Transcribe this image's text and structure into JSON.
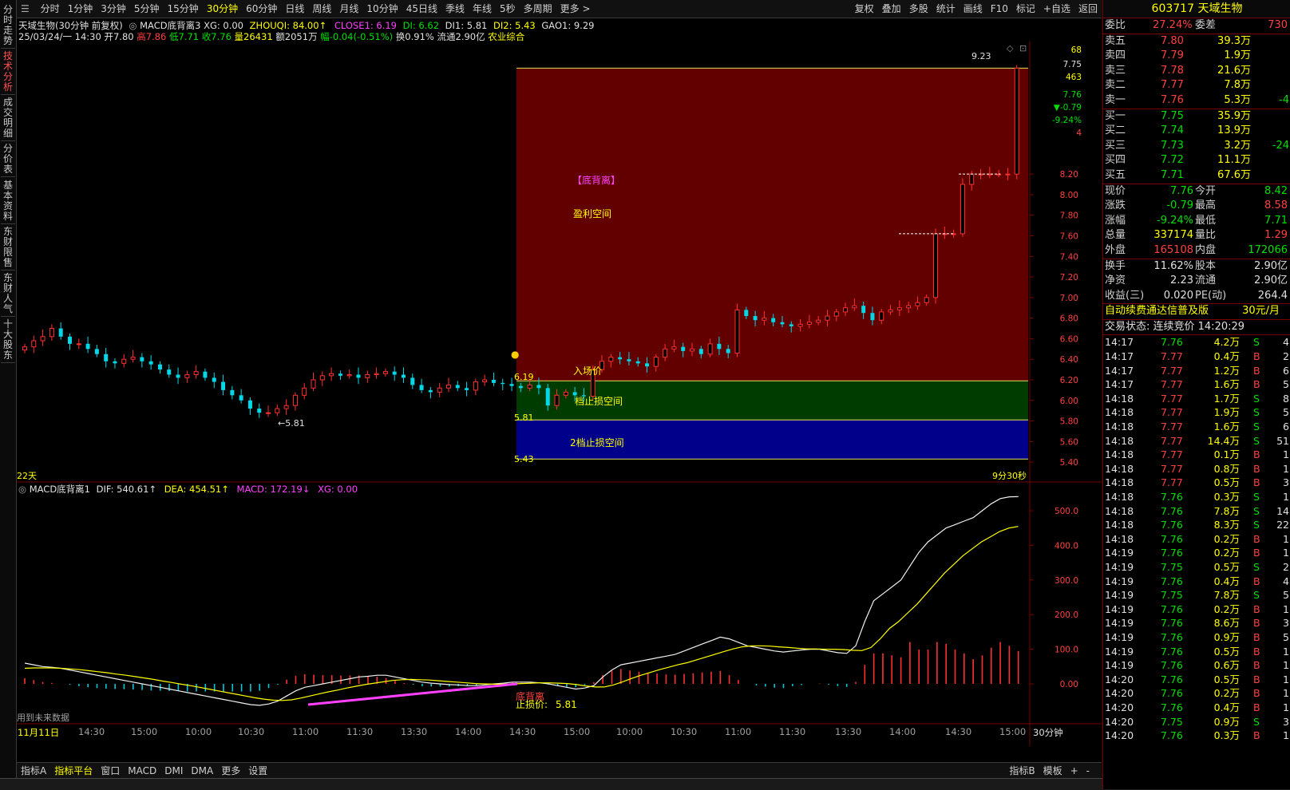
{
  "left_tabs": [
    {
      "label": "分时走势",
      "active": false
    },
    {
      "label": "技术分析",
      "active": true
    },
    {
      "label": "成交明细",
      "active": false
    },
    {
      "label": "分价表",
      "active": false
    },
    {
      "label": "基本资料",
      "active": false
    },
    {
      "label": "东财限售",
      "active": false
    },
    {
      "label": "东财人气",
      "active": false
    },
    {
      "label": "十大股东",
      "active": false
    }
  ],
  "periods": [
    {
      "label": "分时",
      "active": false
    },
    {
      "label": "1分钟",
      "active": false
    },
    {
      "label": "3分钟",
      "active": false
    },
    {
      "label": "5分钟",
      "active": false
    },
    {
      "label": "15分钟",
      "active": false
    },
    {
      "label": "30分钟",
      "active": true
    },
    {
      "label": "60分钟",
      "active": false
    },
    {
      "label": "日线",
      "active": false
    },
    {
      "label": "周线",
      "active": false
    },
    {
      "label": "月线",
      "active": false
    },
    {
      "label": "10分钟",
      "active": false
    },
    {
      "label": "45日线",
      "active": false
    },
    {
      "label": "季线",
      "active": false
    },
    {
      "label": "年线",
      "active": false
    },
    {
      "label": "5秒",
      "active": false
    },
    {
      "label": "多周期",
      "active": false
    },
    {
      "label": "更多 >",
      "active": false
    }
  ],
  "right_toolbar": [
    "复权",
    "叠加",
    "多股",
    "统计",
    "画线",
    "F10",
    "标记",
    "+自选",
    "返回"
  ],
  "info1": {
    "name": "天域生物(30分钟 前复权)",
    "formula": "MACD底背离3",
    "xg": "XG: 0.00",
    "zhouqi": "ZHOUQI: 84.00↑",
    "close1": "CLOSE1: 6.19",
    "di": "DI: 6.62",
    "di1": "DI1: 5.81",
    "di2": "DI2: 5.43",
    "gao1": "GAO1: 9.29"
  },
  "info2": {
    "date": "25/03/24/一 14:30",
    "open": "开7.80",
    "high": "高7.86",
    "low": "低7.71",
    "close": "收7.76",
    "vol": "量26431",
    "amount": "额2051万",
    "change": "幅-0.04(-0.51%)",
    "turnover": "换0.91%",
    "float": "流通2.90亿",
    "sector": "农业综合"
  },
  "main_chart": {
    "price_min": 5.3,
    "price_max": 9.45,
    "y_ticks": [
      8.2,
      8.0,
      7.8,
      7.6,
      7.4,
      7.2,
      7.0,
      6.8,
      6.6,
      6.4,
      6.2,
      6.0,
      5.8,
      5.6,
      5.4
    ],
    "y_tick_labels": [
      "8.20",
      "8.00",
      "7.80",
      "7.60",
      "7.40",
      "7.20",
      "7.00",
      "6.80",
      "6.60",
      "6.40",
      "6.20",
      "6.00",
      "5.80",
      "5.60",
      "5.40"
    ],
    "top_axis_labels": [
      "7.76",
      "68",
      "7.75",
      "463",
      "7.76",
      "▼-0.79",
      "-9.24%",
      "4"
    ],
    "zone_labels": {
      "divergence": "【底背离】",
      "profit": "盈利空间",
      "entry": "入场价",
      "stop1": "档止损空间",
      "stop2": "2档止损空间"
    },
    "price_labels": {
      "entry": "6.19",
      "stop1": "5.81",
      "stop2": "5.43",
      "high": "9.23",
      "low_mark": "←5.81"
    },
    "levels": {
      "entry": 6.19,
      "stop1": 5.81,
      "stop2": 5.43,
      "high": 9.23
    },
    "days_label": "22天",
    "countdown": "9分30秒"
  },
  "macd_info": {
    "name": "MACD底背离1",
    "dif": "DIF: 540.61↑",
    "dea": "DEA: 454.51↑",
    "macd": "MACD: 172.19↓",
    "xg": "XG: 0.00"
  },
  "macd_chart": {
    "y_ticks": [
      500,
      400,
      300,
      200,
      100,
      0
    ],
    "y_tick_labels": [
      "500.0",
      "400.0",
      "300.0",
      "200.0",
      "100.0",
      "0.00"
    ],
    "divergence_label": "底背离",
    "stop_label": "止损价:",
    "stop_value": "5.81",
    "future_note": "用到未来数据"
  },
  "x_labels": [
    "11月11日",
    "14:30",
    "15:00",
    "10:00",
    "10:30",
    "11:00",
    "11:30",
    "13:30",
    "14:00",
    "14:30",
    "15:00",
    "10:00",
    "10:30",
    "11:00",
    "11:30",
    "13:30",
    "14:00",
    "14:30",
    "15:00"
  ],
  "period_label": "30分钟",
  "bottom_tabs": [
    {
      "label": "指标A",
      "active": false
    },
    {
      "label": "指标平台",
      "active": true
    },
    {
      "label": "窗口",
      "active": false
    },
    {
      "label": "MACD",
      "active": false
    },
    {
      "label": "DMI",
      "active": false
    },
    {
      "label": "DMA",
      "active": false
    },
    {
      "label": "更多",
      "active": false
    },
    {
      "label": "设置",
      "active": false
    }
  ],
  "bottom_right_tabs": [
    "指标B",
    "模板",
    "+",
    "-"
  ],
  "right_panel": {
    "code": "603717",
    "name": "天域生物",
    "weibi_label": "委比",
    "weibi": "27.24%",
    "weicha_label": "委差",
    "weicha": "730",
    "asks": [
      {
        "label": "卖五",
        "price": "7.80",
        "vol": "39.3万",
        "chg": ""
      },
      {
        "label": "卖四",
        "price": "7.79",
        "vol": "1.9万",
        "chg": ""
      },
      {
        "label": "卖三",
        "price": "7.78",
        "vol": "21.6万",
        "chg": ""
      },
      {
        "label": "卖二",
        "price": "7.77",
        "vol": "7.8万",
        "chg": ""
      },
      {
        "label": "卖一",
        "price": "7.76",
        "vol": "5.3万",
        "chg": "-4"
      }
    ],
    "bids": [
      {
        "label": "买一",
        "price": "7.75",
        "vol": "35.9万",
        "chg": ""
      },
      {
        "label": "买二",
        "price": "7.74",
        "vol": "13.9万",
        "chg": ""
      },
      {
        "label": "买三",
        "price": "7.73",
        "vol": "3.2万",
        "chg": "-24"
      },
      {
        "label": "买四",
        "price": "7.72",
        "vol": "11.1万",
        "chg": ""
      },
      {
        "label": "买五",
        "price": "7.71",
        "vol": "67.6万",
        "chg": ""
      }
    ],
    "stats": [
      {
        "l1": "现价",
        "v1": "7.76",
        "l2": "今开",
        "v2": "8.42",
        "c1": "#00e000",
        "c2": "#00e000"
      },
      {
        "l1": "涨跌",
        "v1": "-0.79",
        "l2": "最高",
        "v2": "8.58",
        "c1": "#00e000",
        "c2": "#ff4040"
      },
      {
        "l1": "涨幅",
        "v1": "-9.24%",
        "l2": "最低",
        "v2": "7.71",
        "c1": "#00e000",
        "c2": "#00e000"
      },
      {
        "l1": "总量",
        "v1": "337174",
        "l2": "量比",
        "v2": "1.29",
        "c1": "#ffff00",
        "c2": "#ff4040"
      },
      {
        "l1": "外盘",
        "v1": "165108",
        "l2": "内盘",
        "v2": "172066",
        "c1": "#ff4040",
        "c2": "#00e000"
      }
    ],
    "stats2": [
      {
        "l1": "换手",
        "v1": "11.62%",
        "l2": "股本",
        "v2": "2.90亿"
      },
      {
        "l1": "净资",
        "v1": "2.23",
        "l2": "流通",
        "v2": "2.90亿"
      },
      {
        "l1": "收益(三)",
        "v1": "0.020",
        "l2": "PE(动)",
        "v2": "264.4"
      }
    ],
    "ad_text": "自动续费通达信普及版",
    "ad_price": "30元/月",
    "trade_state": "交易状态: 连续竞价 14:20:29",
    "ticks": [
      {
        "t": "14:17",
        "p": "7.76",
        "v": "4.2万",
        "d": "S",
        "n": "4"
      },
      {
        "t": "14:17",
        "p": "7.77",
        "v": "0.4万",
        "d": "B",
        "n": "2"
      },
      {
        "t": "14:17",
        "p": "7.77",
        "v": "1.2万",
        "d": "B",
        "n": "6"
      },
      {
        "t": "14:17",
        "p": "7.77",
        "v": "1.6万",
        "d": "B",
        "n": "5"
      },
      {
        "t": "14:18",
        "p": "7.77",
        "v": "1.7万",
        "d": "S",
        "n": "8"
      },
      {
        "t": "14:18",
        "p": "7.77",
        "v": "1.9万",
        "d": "S",
        "n": "5"
      },
      {
        "t": "14:18",
        "p": "7.77",
        "v": "1.6万",
        "d": "S",
        "n": "6"
      },
      {
        "t": "14:18",
        "p": "7.77",
        "v": "14.4万",
        "d": "S",
        "n": "51"
      },
      {
        "t": "14:18",
        "p": "7.77",
        "v": "0.1万",
        "d": "B",
        "n": "1"
      },
      {
        "t": "14:18",
        "p": "7.77",
        "v": "0.8万",
        "d": "B",
        "n": "1"
      },
      {
        "t": "14:18",
        "p": "7.77",
        "v": "0.5万",
        "d": "B",
        "n": "3"
      },
      {
        "t": "14:18",
        "p": "7.76",
        "v": "0.3万",
        "d": "S",
        "n": "1"
      },
      {
        "t": "14:18",
        "p": "7.76",
        "v": "7.8万",
        "d": "S",
        "n": "14"
      },
      {
        "t": "14:18",
        "p": "7.76",
        "v": "8.3万",
        "d": "S",
        "n": "22"
      },
      {
        "t": "14:18",
        "p": "7.76",
        "v": "0.2万",
        "d": "B",
        "n": "1"
      },
      {
        "t": "14:19",
        "p": "7.76",
        "v": "0.2万",
        "d": "B",
        "n": "1"
      },
      {
        "t": "14:19",
        "p": "7.75",
        "v": "0.5万",
        "d": "S",
        "n": "2"
      },
      {
        "t": "14:19",
        "p": "7.76",
        "v": "0.4万",
        "d": "B",
        "n": "4"
      },
      {
        "t": "14:19",
        "p": "7.75",
        "v": "7.8万",
        "d": "S",
        "n": "5"
      },
      {
        "t": "14:19",
        "p": "7.76",
        "v": "0.2万",
        "d": "B",
        "n": "1"
      },
      {
        "t": "14:19",
        "p": "7.76",
        "v": "8.6万",
        "d": "B",
        "n": "3"
      },
      {
        "t": "14:19",
        "p": "7.76",
        "v": "0.9万",
        "d": "B",
        "n": "5"
      },
      {
        "t": "14:19",
        "p": "7.76",
        "v": "0.5万",
        "d": "B",
        "n": "1"
      },
      {
        "t": "14:19",
        "p": "7.76",
        "v": "0.6万",
        "d": "B",
        "n": "1"
      },
      {
        "t": "14:20",
        "p": "7.76",
        "v": "0.5万",
        "d": "B",
        "n": "1"
      },
      {
        "t": "14:20",
        "p": "7.76",
        "v": "0.2万",
        "d": "B",
        "n": "1"
      },
      {
        "t": "14:20",
        "p": "7.76",
        "v": "0.4万",
        "d": "B",
        "n": "1"
      },
      {
        "t": "14:20",
        "p": "7.75",
        "v": "0.9万",
        "d": "S",
        "n": "3"
      },
      {
        "t": "14:20",
        "p": "7.76",
        "v": "0.3万",
        "d": "B",
        "n": "1"
      }
    ]
  },
  "chart_data": {
    "type": "candlestick",
    "closes": [
      6.52,
      6.58,
      6.62,
      6.7,
      6.62,
      6.55,
      6.55,
      6.5,
      6.45,
      6.38,
      6.36,
      6.4,
      6.42,
      6.38,
      6.35,
      6.3,
      6.25,
      6.22,
      6.25,
      6.28,
      6.22,
      6.18,
      6.1,
      6.05,
      6.0,
      5.92,
      5.88,
      5.88,
      5.92,
      5.95,
      6.05,
      6.12,
      6.2,
      6.24,
      6.26,
      6.24,
      6.25,
      6.22,
      6.25,
      6.26,
      6.28,
      6.25,
      6.22,
      6.15,
      6.1,
      6.08,
      6.12,
      6.15,
      6.12,
      6.1,
      6.18,
      6.2,
      6.17,
      6.16,
      6.14,
      6.12,
      6.15,
      6.12,
      5.95,
      6.05,
      6.08,
      6.05,
      6.04,
      6.3,
      6.38,
      6.42,
      6.4,
      6.38,
      6.36,
      6.33,
      6.42,
      6.5,
      6.52,
      6.48,
      6.5,
      6.45,
      6.55,
      6.5,
      6.46,
      6.88,
      6.82,
      6.78,
      6.8,
      6.76,
      6.74,
      6.72,
      6.74,
      6.76,
      6.78,
      6.82,
      6.86,
      6.9,
      6.92,
      6.85,
      6.78,
      6.86,
      6.88,
      6.9,
      6.92,
      6.95,
      7.0,
      7.62,
      7.62,
      7.62,
      8.1,
      8.2,
      8.2,
      8.2,
      8.2,
      8.2,
      9.23
    ],
    "dif": [
      60,
      55,
      50,
      48,
      45,
      40,
      35,
      30,
      25,
      20,
      15,
      10,
      5,
      0,
      -5,
      -10,
      -15,
      -20,
      -25,
      -30,
      -35,
      -40,
      -45,
      -50,
      -55,
      -60,
      -62,
      -58,
      -50,
      -35,
      -20,
      -10,
      -5,
      0,
      5,
      10,
      15,
      20,
      22,
      25,
      25,
      20,
      15,
      10,
      5,
      2,
      0,
      -2,
      -3,
      -5,
      -5,
      -3,
      0,
      2,
      5,
      5,
      5,
      3,
      0,
      -5,
      -10,
      -15,
      -12,
      -5,
      20,
      40,
      55,
      60,
      65,
      70,
      75,
      80,
      85,
      95,
      105,
      115,
      125,
      135,
      130,
      120,
      110,
      105,
      100,
      95,
      92,
      95,
      98,
      100,
      100,
      95,
      90,
      88,
      110,
      180,
      240,
      260,
      280,
      300,
      340,
      380,
      410,
      430,
      450,
      460,
      470,
      480,
      500,
      520,
      535,
      540,
      540.61
    ],
    "dea": [
      45,
      46,
      46,
      46,
      45,
      43,
      41,
      38,
      35,
      32,
      28,
      25,
      21,
      17,
      13,
      8,
      4,
      -1,
      -5,
      -10,
      -15,
      -20,
      -25,
      -30,
      -35,
      -40,
      -44,
      -47,
      -48,
      -46,
      -41,
      -35,
      -29,
      -23,
      -18,
      -12,
      -7,
      -2,
      2,
      6,
      10,
      12,
      13,
      12,
      11,
      9,
      7,
      5,
      3,
      1,
      0,
      -1,
      -1,
      0,
      1,
      2,
      3,
      3,
      2,
      1,
      -2,
      -6,
      -9,
      -9,
      -3,
      6,
      16,
      25,
      33,
      41,
      48,
      55,
      61,
      69,
      77,
      85,
      93,
      101,
      107,
      110,
      110,
      109,
      107,
      105,
      103,
      101,
      101,
      100,
      100,
      99,
      97,
      96,
      105,
      130,
      160,
      180,
      205,
      230,
      260,
      290,
      320,
      345,
      370,
      390,
      410,
      425,
      440,
      450,
      454.51
    ],
    "macd": [
      30,
      20,
      10,
      5,
      0,
      -5,
      -12,
      -18,
      -22,
      -25,
      -27,
      -28,
      -30,
      -32,
      -35,
      -36,
      -38,
      -38,
      -40,
      -40,
      -40,
      -40,
      -40,
      -40,
      -40,
      -40,
      -36,
      -22,
      -4,
      22,
      42,
      50,
      48,
      46,
      46,
      44,
      44,
      44,
      40,
      38,
      30,
      16,
      4,
      -4,
      -12,
      -14,
      -14,
      -14,
      -12,
      -12,
      -10,
      -4,
      2,
      4,
      8,
      6,
      4,
      0,
      -4,
      -12,
      -16,
      -18,
      -6,
      8,
      46,
      68,
      78,
      70,
      64,
      58,
      54,
      50,
      48,
      52,
      56,
      60,
      64,
      68,
      46,
      20,
      0,
      -8,
      -14,
      -20,
      -22,
      -12,
      -6,
      0,
      2,
      -4,
      -12,
      -16,
      10,
      100,
      160,
      160,
      150,
      140,
      220,
      180,
      180,
      220,
      210,
      180,
      160,
      130,
      150,
      190,
      220,
      200,
      172.19
    ]
  }
}
